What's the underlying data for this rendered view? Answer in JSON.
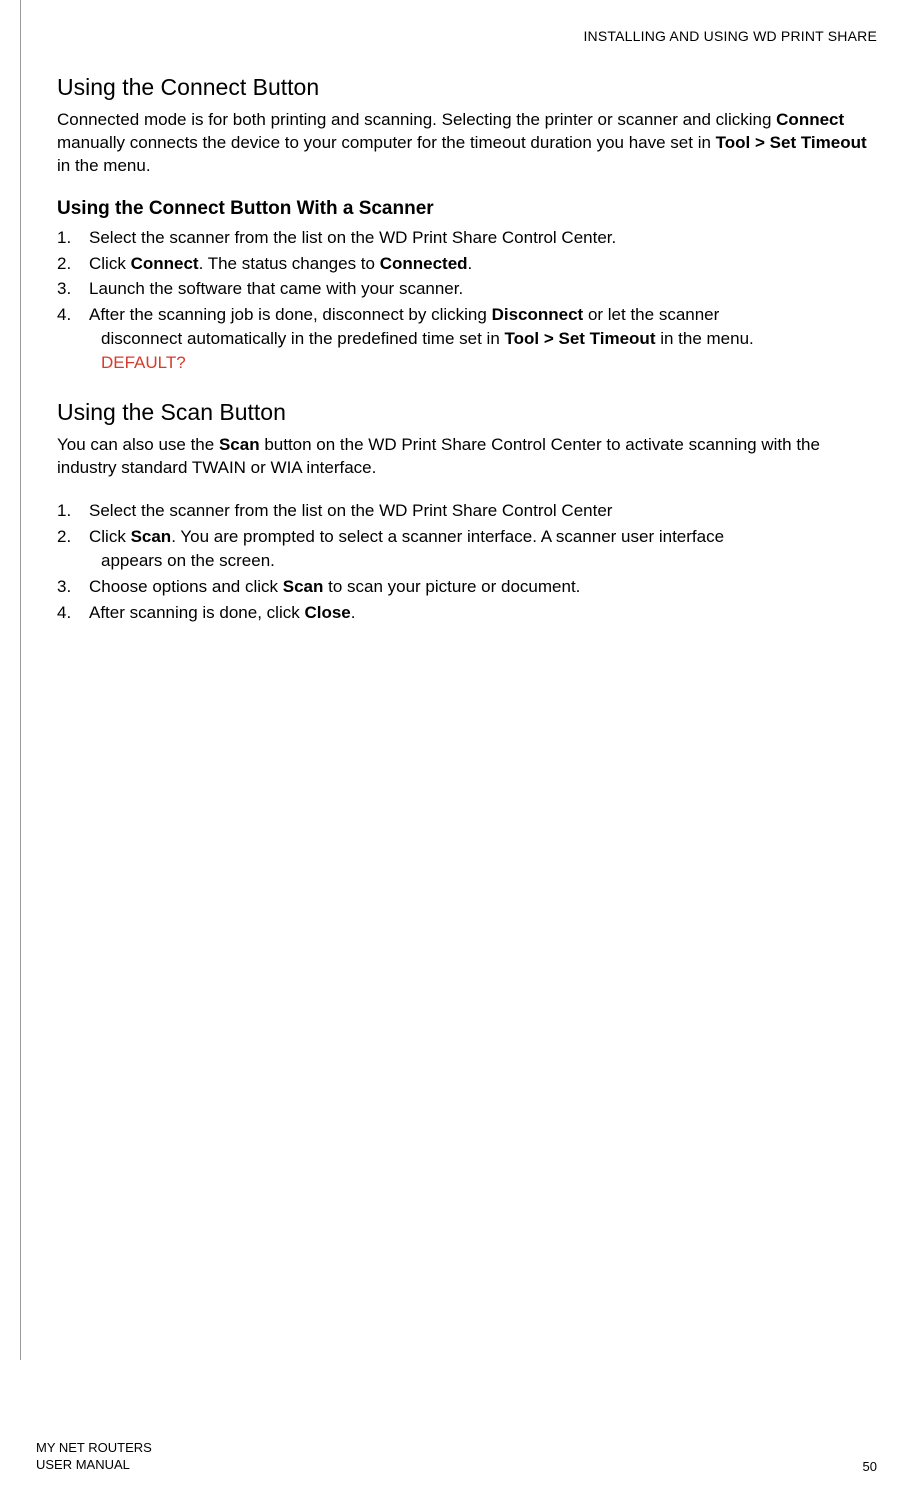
{
  "header": {
    "chapter": "INSTALLING AND USING WD PRINT SHARE"
  },
  "section1": {
    "title": "Using the Connect Button",
    "intro_1": "Connected mode is for both printing and scanning. Selecting the printer or scanner and clicking ",
    "intro_bold1": "Connect",
    "intro_2": " manually connects the device to your computer for the timeout duration you have set in ",
    "intro_bold2": "Tool > Set Timeout",
    "intro_3": " in the menu.",
    "subheading": "Using the Connect Button With a Scanner",
    "steps": {
      "s1_num": "1.",
      "s1_text": "Select the scanner from the list on the WD Print Share Control Center.",
      "s2_num": "2.",
      "s2_a": "Click ",
      "s2_bold1": "Connect",
      "s2_b": ". The status changes to ",
      "s2_bold2": "Connected",
      "s2_c": ".",
      "s3_num": "3.",
      "s3_text": "Launch the software that came with your scanner.",
      "s4_num": "4.",
      "s4_a": "After the scanning job is done, disconnect by clicking ",
      "s4_bold1": "Disconnect",
      "s4_b": " or let the scanner",
      "s4_cont_a": "disconnect automatically in the predefined time set in ",
      "s4_cont_bold": "Tool > Set Timeout",
      "s4_cont_b": " in the menu.",
      "s4_red": "DEFAULT?"
    }
  },
  "section2": {
    "title": "Using the Scan Button",
    "intro_1": "You can also use the ",
    "intro_bold1": "Scan",
    "intro_2": " button on the WD Print Share Control Center to activate scanning with the industry standard TWAIN or WIA interface.",
    "steps": {
      "s1_num": "1.",
      "s1_text": "Select the scanner from the list on the WD Print Share Control Center",
      "s2_num": "2.",
      "s2_a": "Click ",
      "s2_bold1": "Scan",
      "s2_b": ". You are prompted to select a scanner interface. A scanner user interface",
      "s2_cont": "appears on the screen.",
      "s3_num": "3.",
      "s3_a": "Choose options and click ",
      "s3_bold": "Scan",
      "s3_b": " to scan your picture or document.",
      "s4_num": "4.",
      "s4_a": "After scanning is done, click ",
      "s4_bold": "Close",
      "s4_b": "."
    }
  },
  "footer": {
    "left_line1": "MY NET ROUTERS",
    "left_line2": "USER MANUAL",
    "page_num": "50"
  }
}
